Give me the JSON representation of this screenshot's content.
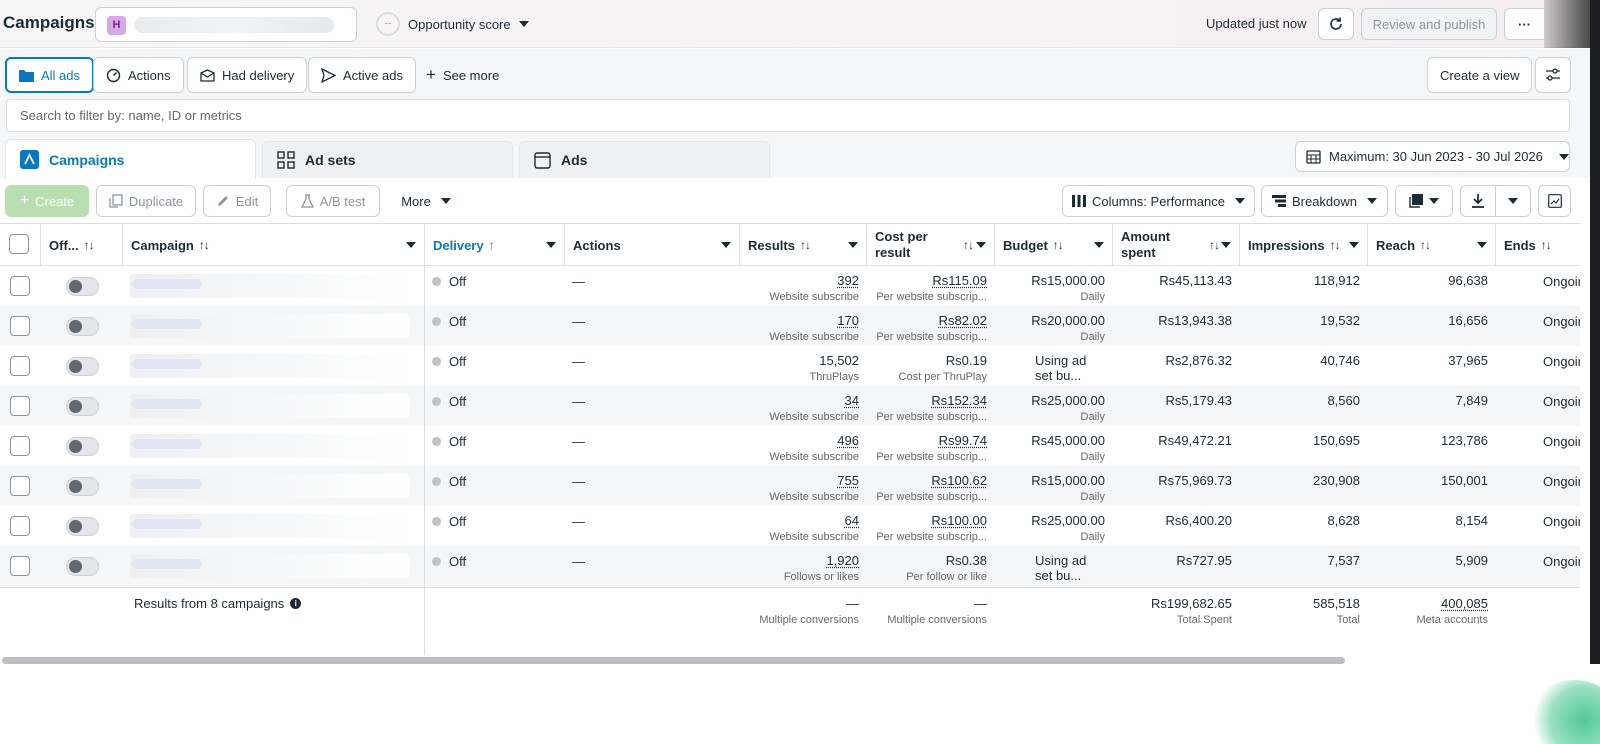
{
  "header": {
    "title": "Campaigns",
    "account_initial": "H",
    "opportunity": {
      "icon_text": "--",
      "label": "Opportunity score"
    },
    "updated": "Updated just now",
    "review_publish": "Review and publish",
    "more_icon": "ellipsis-icon"
  },
  "views": {
    "all_ads": "All ads",
    "actions": "Actions",
    "had_delivery": "Had delivery",
    "active_ads": "Active ads",
    "see_more": "See more",
    "create_view": "Create a view"
  },
  "search": {
    "placeholder": "Search to filter by: name, ID or metrics"
  },
  "tabs": {
    "campaigns": "Campaigns",
    "ad_sets": "Ad sets",
    "ads": "Ads"
  },
  "date_range": "Maximum: 30 Jun 2023 - 30 Jul 2026",
  "toolbar": {
    "create": "Create",
    "duplicate": "Duplicate",
    "edit": "Edit",
    "ab_test": "A/B test",
    "more": "More",
    "columns": "Columns: Performance",
    "breakdown": "Breakdown"
  },
  "columns": {
    "off_on": "Off...",
    "campaign": "Campaign",
    "delivery": "Delivery",
    "actions": "Actions",
    "results": "Results",
    "cost_per_result_1": "Cost per",
    "cost_per_result_2": "result",
    "budget": "Budget",
    "amount_spent_1": "Amount",
    "amount_spent_2": "spent",
    "impressions": "Impressions",
    "reach": "Reach",
    "ends": "Ends"
  },
  "rows": [
    {
      "delivery": "Off",
      "actions": "—",
      "results": "392",
      "results_sub": "Website subscribe",
      "cost": "Rs115.09",
      "cost_sub": "Per website subscrip...",
      "budget": "Rs15,000.00",
      "budget_sub": "Daily",
      "spent": "Rs45,113.43",
      "impressions": "118,912",
      "reach": "96,638",
      "ends": "Ongoing"
    },
    {
      "delivery": "Off",
      "actions": "—",
      "results": "170",
      "results_sub": "Website subscribe",
      "cost": "Rs82.02",
      "cost_sub": "Per website subscrip...",
      "budget": "Rs20,000.00",
      "budget_sub": "Daily",
      "spent": "Rs13,943.38",
      "impressions": "19,532",
      "reach": "16,656",
      "ends": "Ongoing"
    },
    {
      "delivery": "Off",
      "actions": "—",
      "results": "15,502",
      "results_sub": "ThruPlays",
      "cost": "Rs0.19",
      "cost_sub": "Cost per ThruPlay",
      "budget": "Using ad set bu...",
      "budget_sub": "",
      "spent": "Rs2,876.32",
      "impressions": "40,746",
      "reach": "37,965",
      "ends": "Ongoing"
    },
    {
      "delivery": "Off",
      "actions": "—",
      "results": "34",
      "results_sub": "Website subscribe",
      "cost": "Rs152.34",
      "cost_sub": "Per website subscrip...",
      "budget": "Rs25,000.00",
      "budget_sub": "Daily",
      "spent": "Rs5,179.43",
      "impressions": "8,560",
      "reach": "7,849",
      "ends": "Ongoing"
    },
    {
      "delivery": "Off",
      "actions": "—",
      "results": "496",
      "results_sub": "Website subscribe",
      "cost": "Rs99.74",
      "cost_sub": "Per website subscrip...",
      "budget": "Rs45,000.00",
      "budget_sub": "Daily",
      "spent": "Rs49,472.21",
      "impressions": "150,695",
      "reach": "123,786",
      "ends": "Ongoing"
    },
    {
      "delivery": "Off",
      "actions": "—",
      "results": "755",
      "results_sub": "Website subscribe",
      "cost": "Rs100.62",
      "cost_sub": "Per website subscrip...",
      "budget": "Rs15,000.00",
      "budget_sub": "Daily",
      "spent": "Rs75,969.73",
      "impressions": "230,908",
      "reach": "150,001",
      "ends": "Ongoing"
    },
    {
      "delivery": "Off",
      "actions": "—",
      "results": "64",
      "results_sub": "Website subscribe",
      "cost": "Rs100.00",
      "cost_sub": "Per website subscrip...",
      "budget": "Rs25,000.00",
      "budget_sub": "Daily",
      "spent": "Rs6,400.20",
      "impressions": "8,628",
      "reach": "8,154",
      "ends": "Ongoing"
    },
    {
      "delivery": "Off",
      "actions": "—",
      "results": "1,920",
      "results_sub": "Follows or likes",
      "cost": "Rs0.38",
      "cost_sub": "Per follow or like",
      "budget": "Using ad set bu...",
      "budget_sub": "",
      "spent": "Rs727.95",
      "impressions": "7,537",
      "reach": "5,909",
      "ends": "Ongoing"
    }
  ],
  "footer": {
    "label": "Results from 8 campaigns",
    "results": "—",
    "results_sub": "Multiple conversions",
    "cost": "—",
    "cost_sub": "Multiple conversions",
    "spent": "Rs199,682.65",
    "spent_sub": "Total Spent",
    "impressions": "585,518",
    "impressions_sub": "Total",
    "reach": "400,085",
    "reach_sub": "Meta accounts"
  },
  "colors": {
    "accent": "#0a78be",
    "create": "#42b72a"
  }
}
